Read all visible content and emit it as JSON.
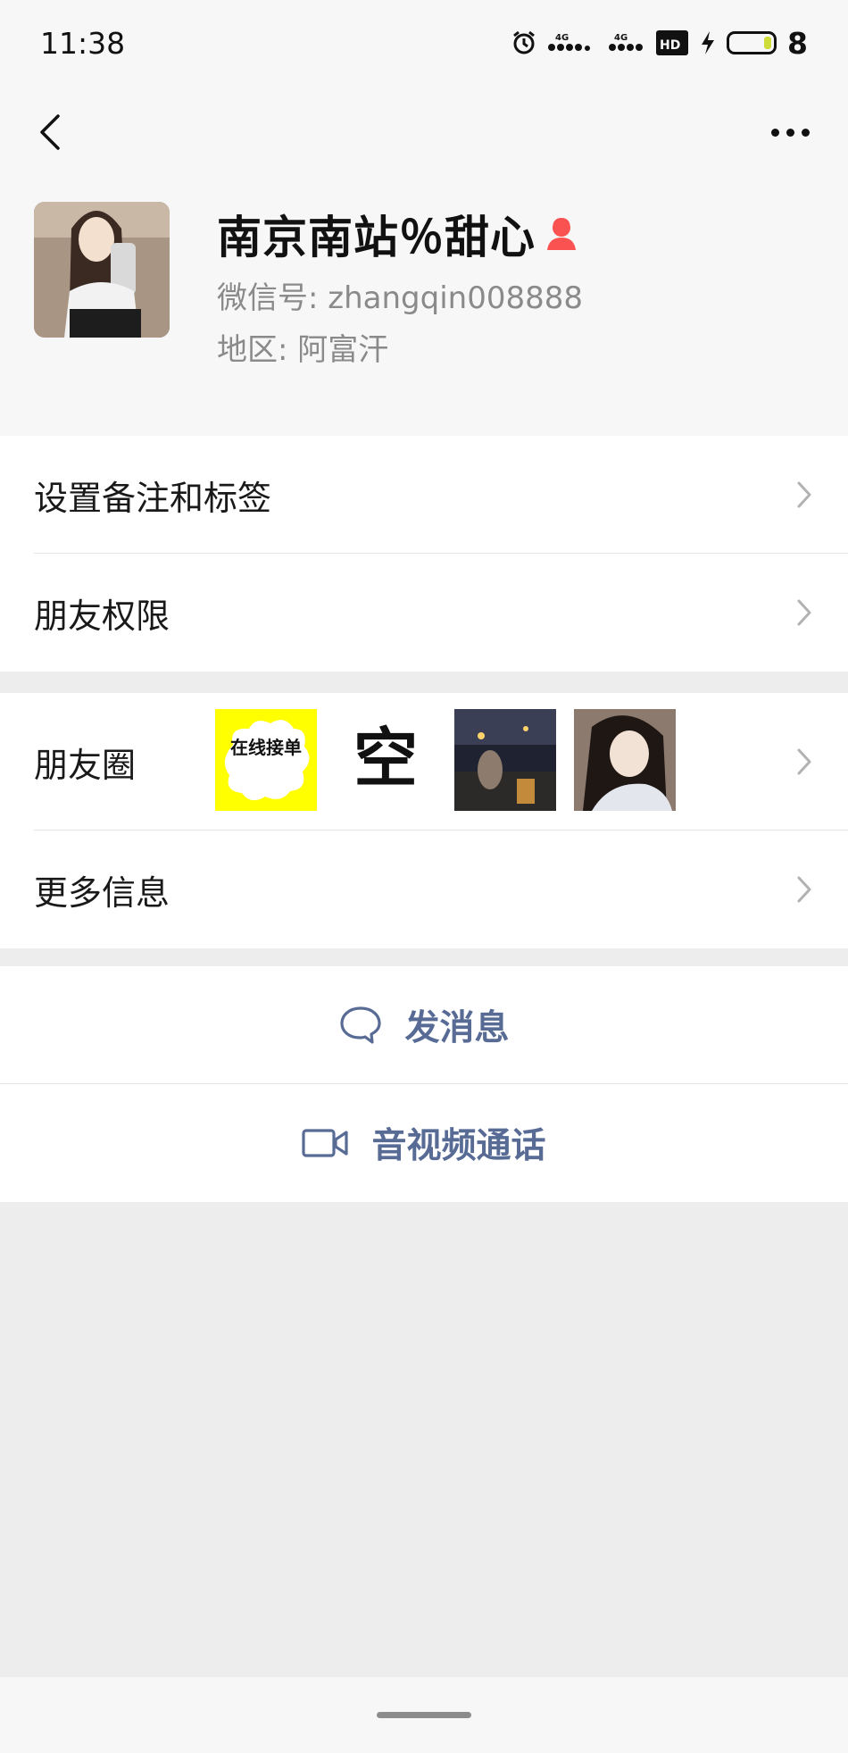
{
  "status_bar": {
    "time": "11:38",
    "battery_level": "8",
    "icons": [
      "alarm-icon",
      "signal-4g-icon",
      "signal-4g-icon",
      "hd-icon",
      "charging-icon",
      "battery-icon"
    ]
  },
  "profile": {
    "name": "南京南站％甜心",
    "wechat_id": "微信号: zhangqin008888",
    "region": "地区: 阿富汗",
    "gender_icon": "female-icon",
    "gender_color": "#fa5151"
  },
  "menu": {
    "remarks_tags": "设置备注和标签",
    "friend_permissions": "朋友权限",
    "moments": "朋友圈",
    "more_info": "更多信息"
  },
  "moments_thumbs": {
    "thumb1_text": "在线接单",
    "thumb2_text": "空"
  },
  "actions": {
    "send_message": "发消息",
    "video_call": "音视频通话"
  },
  "colors": {
    "link": "#576b95",
    "background": "#ededed",
    "card": "#ffffff"
  }
}
